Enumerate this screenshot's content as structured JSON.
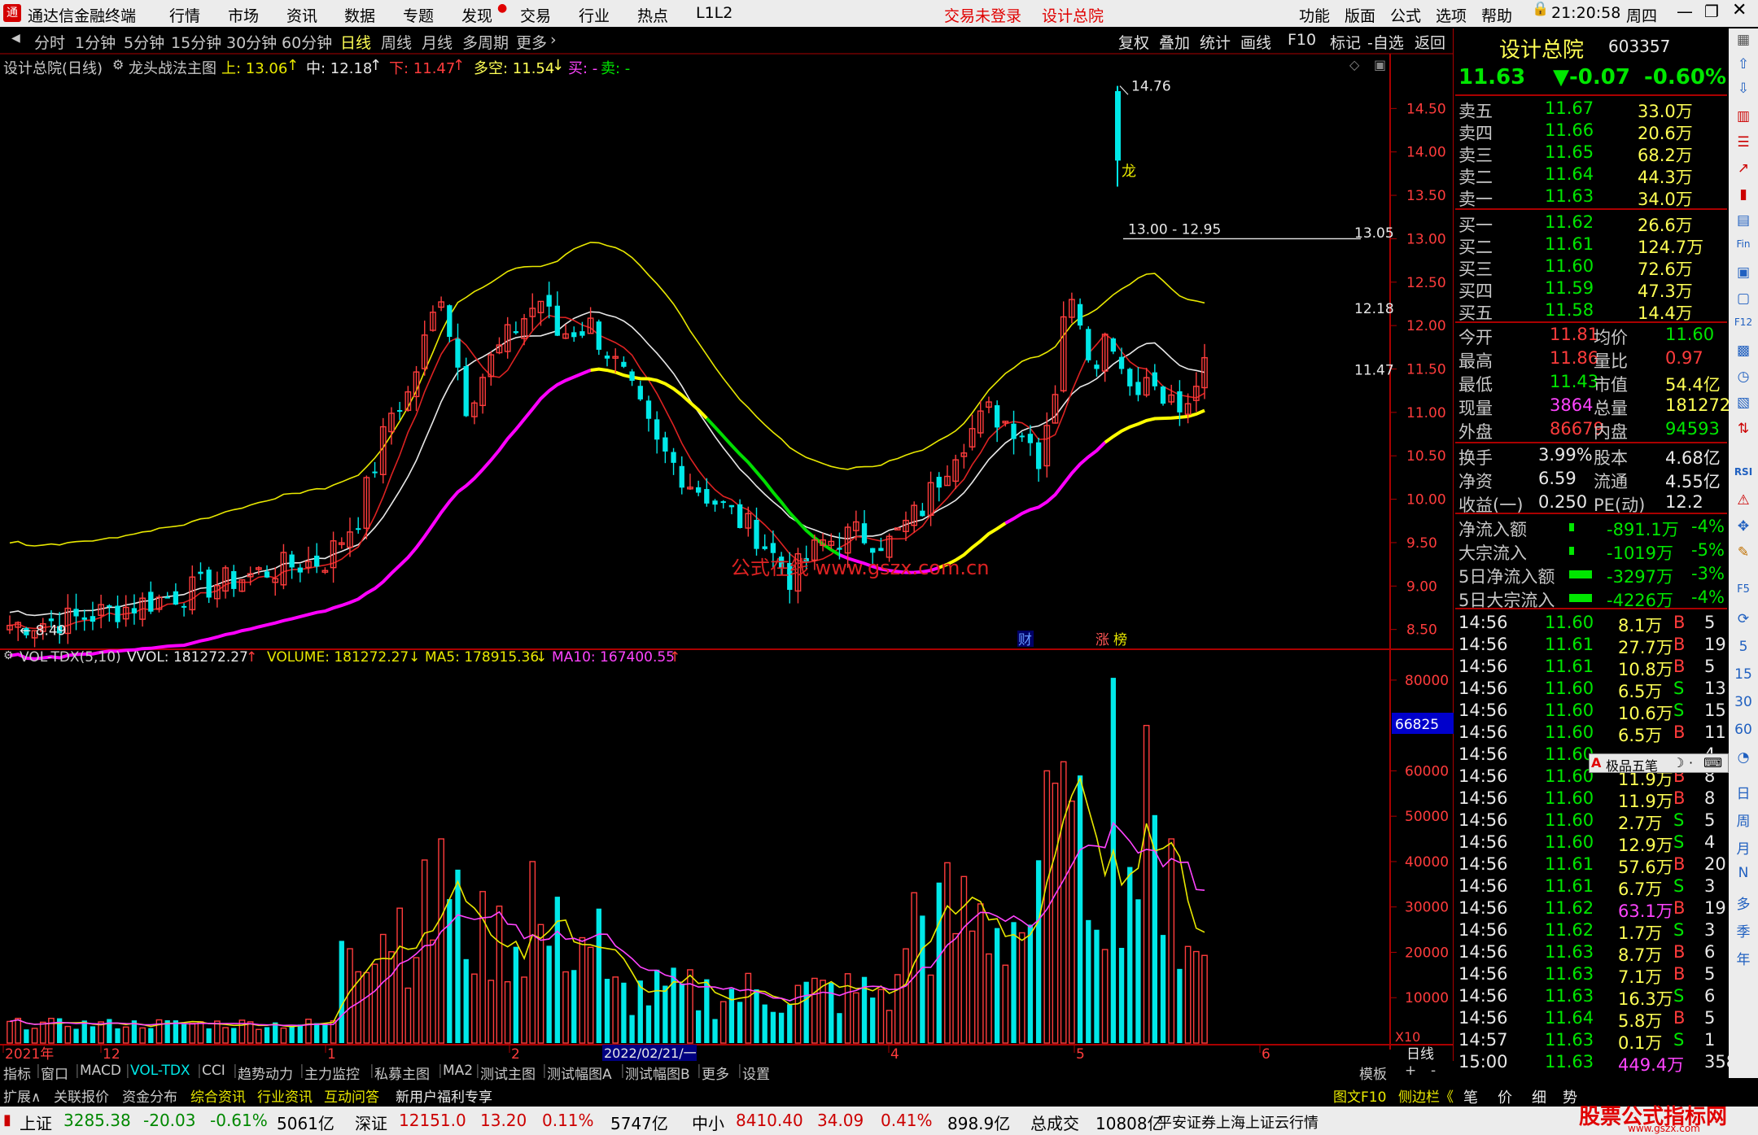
{
  "titlebar": {
    "app": "通达信金融终端",
    "menus": [
      "行情",
      "市场",
      "资讯",
      "数据",
      "专题",
      "发现",
      "交易",
      "行业",
      "热点",
      "L1L2"
    ],
    "trade_status": "交易未登录",
    "stock_name": "设计总院",
    "right_menus": [
      "功能",
      "版面",
      "公式",
      "选项",
      "帮助"
    ],
    "time": "21:20:58",
    "weekday": "周四"
  },
  "periodbar": {
    "periods": [
      "分时",
      "1分钟",
      "5分钟",
      "15分钟",
      "30分钟",
      "60分钟",
      "日线",
      "周线",
      "月线",
      "多周期",
      "更多"
    ],
    "selected": "日线",
    "right_buttons": [
      "复权",
      "叠加",
      "统计",
      "画线",
      "F10",
      "标记",
      "-自选",
      "返回"
    ]
  },
  "main_chart": {
    "name": "设计总院(日线)",
    "indicator": "龙头战法主图",
    "up_label": "上: 13.06",
    "mid_label": "中: 12.18",
    "down_label": "下: 11.47",
    "duokong_label": "多空: 11.54",
    "buy_label": "买: -",
    "sell_label": "卖: -",
    "watermark": "公式在线 www.gszx.com.cn",
    "price_ticks": [
      "14.50",
      "14.00",
      "13.50",
      "13.00",
      "12.50",
      "12.00",
      "11.50",
      "11.00",
      "10.50",
      "10.00",
      "9.50",
      "9.00",
      "8.50"
    ],
    "annotations": {
      "high": "14.76",
      "low": "8.49",
      "level": "13.00 - 12.95",
      "long_marker": "龙",
      "right_1305": "13.05",
      "right_1218": "12.18",
      "right_1147": "11.47",
      "cai": "财",
      "zhang": "涨",
      "bang": "榜"
    }
  },
  "vol_chart": {
    "name": "VOL-TDX(5,10)",
    "vvol": "VVOL: 181272.27",
    "volume": "VOLUME: 181272.27",
    "ma5": "MA5: 178915.36",
    "ma10": "MA10: 167400.55",
    "ticks": [
      "80000",
      "60000",
      "50000",
      "40000",
      "30000",
      "20000",
      "10000"
    ],
    "cursor_value": "66825",
    "scale": "X10"
  },
  "date_axis": {
    "labels": [
      "2021年",
      "12",
      "1",
      "2",
      "4",
      "5",
      "6"
    ],
    "cursor_date": "2022/02/21/一",
    "period": "日线"
  },
  "quote": {
    "name": "设计总院",
    "code": "603357",
    "price": "11.63",
    "change": "▼-0.07",
    "pct": "-0.60%",
    "asks": [
      {
        "label": "卖五",
        "price": "11.67",
        "vol": "33.0万"
      },
      {
        "label": "卖四",
        "price": "11.66",
        "vol": "20.6万"
      },
      {
        "label": "卖三",
        "price": "11.65",
        "vol": "68.2万"
      },
      {
        "label": "卖二",
        "price": "11.64",
        "vol": "44.3万"
      },
      {
        "label": "卖一",
        "price": "11.63",
        "vol": "34.0万"
      }
    ],
    "bids": [
      {
        "label": "买一",
        "price": "11.62",
        "vol": "26.6万"
      },
      {
        "label": "买二",
        "price": "11.61",
        "vol": "124.7万"
      },
      {
        "label": "买三",
        "price": "11.60",
        "vol": "72.6万"
      },
      {
        "label": "买四",
        "price": "11.59",
        "vol": "47.3万"
      },
      {
        "label": "买五",
        "price": "11.58",
        "vol": "14.4万"
      }
    ],
    "stats": [
      {
        "l1": "今开",
        "v1": "11.81",
        "l2": "均价",
        "v2": "11.60"
      },
      {
        "l1": "最高",
        "v1": "11.86",
        "l2": "量比",
        "v2": "0.97"
      },
      {
        "l1": "最低",
        "v1": "11.43",
        "l2": "市值",
        "v2": "54.4亿"
      },
      {
        "l1": "现量",
        "v1": "3864",
        "l2": "总量",
        "v2": "181272"
      },
      {
        "l1": "外盘",
        "v1": "86679",
        "l2": "内盘",
        "v2": "94593"
      }
    ],
    "stats2": [
      {
        "l1": "换手",
        "v1": "3.99%",
        "l2": "股本",
        "v2": "4.68亿"
      },
      {
        "l1": "净资",
        "v1": "6.59",
        "l2": "流通",
        "v2": "4.55亿"
      },
      {
        "l1": "收益(一)",
        "v1": "0.250",
        "l2": "PE(动)",
        "v2": "12.2"
      }
    ],
    "flows": [
      {
        "label": "净流入额",
        "value": "-891.1万",
        "pct": "-4%"
      },
      {
        "label": "大宗流入",
        "value": "-1019万",
        "pct": "-5%"
      },
      {
        "label": "5日净流入额",
        "value": "-3297万",
        "pct": "-3%"
      },
      {
        "label": "5日大宗流入",
        "value": "-4226万",
        "pct": "-4%"
      }
    ],
    "ticks": [
      {
        "t": "14:56",
        "p": "11.60",
        "v": "8.1万",
        "bs": "B",
        "n": "5"
      },
      {
        "t": "14:56",
        "p": "11.61",
        "v": "27.7万",
        "bs": "B",
        "n": "19"
      },
      {
        "t": "14:56",
        "p": "11.61",
        "v": "10.8万",
        "bs": "B",
        "n": "5"
      },
      {
        "t": "14:56",
        "p": "11.60",
        "v": "6.5万",
        "bs": "S",
        "n": "13"
      },
      {
        "t": "14:56",
        "p": "11.60",
        "v": "10.6万",
        "bs": "S",
        "n": "15"
      },
      {
        "t": "14:56",
        "p": "11.60",
        "v": "6.5万",
        "bs": "B",
        "n": "11"
      },
      {
        "t": "14:56",
        "p": "11.60",
        "v": "",
        "bs": "",
        "n": "4"
      },
      {
        "t": "14:56",
        "p": "11.60",
        "v": "11.9万",
        "bs": "B",
        "n": "8"
      },
      {
        "t": "14:56",
        "p": "11.60",
        "v": "11.9万",
        "bs": "B",
        "n": "8"
      },
      {
        "t": "14:56",
        "p": "11.60",
        "v": "2.7万",
        "bs": "S",
        "n": "5"
      },
      {
        "t": "14:56",
        "p": "11.60",
        "v": "12.9万",
        "bs": "S",
        "n": "4"
      },
      {
        "t": "14:56",
        "p": "11.61",
        "v": "57.6万",
        "bs": "B",
        "n": "20"
      },
      {
        "t": "14:56",
        "p": "11.61",
        "v": "6.7万",
        "bs": "S",
        "n": "3"
      },
      {
        "t": "14:56",
        "p": "11.62",
        "v": "63.1万",
        "bs": "B",
        "n": "19"
      },
      {
        "t": "14:56",
        "p": "11.62",
        "v": "1.7万",
        "bs": "S",
        "n": "3"
      },
      {
        "t": "14:56",
        "p": "11.63",
        "v": "8.7万",
        "bs": "B",
        "n": "6"
      },
      {
        "t": "14:56",
        "p": "11.63",
        "v": "7.1万",
        "bs": "B",
        "n": "5"
      },
      {
        "t": "14:56",
        "p": "11.63",
        "v": "16.3万",
        "bs": "S",
        "n": "6"
      },
      {
        "t": "14:56",
        "p": "11.64",
        "v": "5.8万",
        "bs": "B",
        "n": "5"
      },
      {
        "t": "14:57",
        "p": "11.63",
        "v": "0.1万",
        "bs": "S",
        "n": "1"
      },
      {
        "t": "15:00",
        "p": "11.63",
        "v": "449.4万",
        "bs": "",
        "n": "358"
      }
    ],
    "ime": "极品五笔",
    "ime_letter": "A"
  },
  "sidebar_labels": [
    "RSI",
    "F5",
    "5",
    "15",
    "30",
    "60",
    "日",
    "周",
    "月",
    "N",
    "多",
    "季",
    "年"
  ],
  "tabbar1": [
    "指标",
    "窗口",
    "MACD",
    "VOL-TDX",
    "CCI",
    "趋势动力",
    "主力监控",
    "私募主图",
    "MA2",
    "测试主图",
    "测试幅图A",
    "测试幅图B",
    "更多",
    "设置"
  ],
  "tabbar1_selected": "VOL-TDX",
  "tabbar1_right": [
    "模板",
    "+",
    "-"
  ],
  "tabbar2": [
    "扩展∧",
    "关联报价",
    "资金分布",
    "综合资讯",
    "行业资讯",
    "互动问答",
    "新用户福利专享"
  ],
  "tabbar2_right": [
    "图文F10",
    "侧边栏《",
    "笔",
    "价",
    "细",
    "势"
  ],
  "statusbar": {
    "sh_label": "上证",
    "sh_val": "3285.38",
    "sh_chg": "-20.03",
    "sh_pct": "-0.61%",
    "sh_amt": "5061亿",
    "sz_label": "深证",
    "sz_val": "12151.0",
    "sz_chg": "13.20",
    "sz_pct": "0.11%",
    "sz_amt": "5747亿",
    "zx_label": "中小",
    "zx_val": "8410.40",
    "zx_chg": "34.09",
    "zx_pct": "0.41%",
    "zx_amt": "898.9亿",
    "total_label": "总成交",
    "total_val": "10808亿",
    "broker": "平安证券上海上证云行情",
    "brand": "股票公式指标网",
    "brand_url": "www.gszx.com"
  },
  "colors": {
    "up": "#ff3c3c",
    "down": "#00e8e8",
    "bg": "#000000",
    "axis": "#aa0000",
    "yellow": "#e8e800",
    "magenta": "#ff00ff"
  }
}
